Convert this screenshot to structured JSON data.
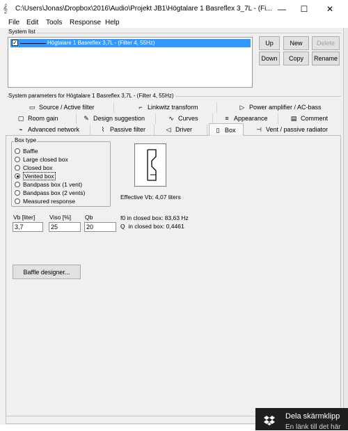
{
  "window": {
    "title": "C:\\Users\\Jonas\\Dropbox\\2016\\Audio\\Projekt JB1\\Högtalare 1 Basreflex 3_7L - (Fi...",
    "minimize": "—",
    "maximize": "☐",
    "close": "✕",
    "app_icon": "speaker-note-icon"
  },
  "menu": [
    "File",
    "Edit",
    "Tools",
    "Response",
    "Help"
  ],
  "system_list": {
    "label": "System list",
    "items": [
      {
        "name": "Högtalare 1 Basreflex 3,7L - (Filter 4, 55Hz)",
        "checked": true,
        "check_glyph": "✓"
      }
    ],
    "buttons": {
      "up": "Up",
      "new": "New",
      "delete": "Delete",
      "down": "Down",
      "copy": "Copy",
      "rename": "Rename"
    }
  },
  "system_parameters": {
    "label": "System parameters for Högtalare 1 Basreflex 3,7L - (Filter 4, 55Hz)"
  },
  "tabs": {
    "row1": [
      {
        "label": "Source / Active filter",
        "icon": "▭",
        "icon_name": "source-icon"
      },
      {
        "label": "Linkwitz transform",
        "icon": "⌐",
        "icon_name": "linkwitz-icon"
      },
      {
        "label": "Power amplifier / AC-bass",
        "icon": "▷",
        "icon_name": "amplifier-icon"
      }
    ],
    "row2": [
      {
        "label": "Room gain",
        "icon": "▢",
        "icon_name": "room-icon"
      },
      {
        "label": "Design suggestion",
        "icon": "✎",
        "icon_name": "pencil-icon"
      },
      {
        "label": "Curves",
        "icon": "∿",
        "icon_name": "curves-icon"
      },
      {
        "label": "Appearance",
        "icon": "≡",
        "icon_name": "appearance-icon"
      },
      {
        "label": "Comment",
        "icon": "▤",
        "icon_name": "comment-icon"
      }
    ],
    "row3": [
      {
        "label": "Advanced network",
        "icon": "⌁",
        "icon_name": "network-icon"
      },
      {
        "label": "Passive filter",
        "icon": "⌇",
        "icon_name": "passive-filter-icon"
      },
      {
        "label": "Driver",
        "icon": "◁",
        "icon_name": "driver-icon"
      },
      {
        "label": "Box",
        "icon": "▯",
        "icon_name": "box-icon"
      },
      {
        "label": "Vent / passive radiator",
        "icon": "⊣",
        "icon_name": "vent-icon"
      }
    ],
    "active": "Box"
  },
  "box_type": {
    "label": "Box type",
    "options": [
      "Baffle",
      "Large closed box",
      "Closed box",
      "Vented box",
      "Bandpass box (1 vent)",
      "Bandpass box (2 vents)",
      "Measured response"
    ],
    "selected": "Vented box"
  },
  "box_info": {
    "effective_vb": "Effective Vb: 4,07 liters",
    "f0_closed": "f0 in closed box: 83,63 Hz",
    "q_closed": "Q  in closed box: 0,4461"
  },
  "fields": {
    "vb": {
      "label": "Vb [liter]",
      "value": "3,7"
    },
    "viso": {
      "label": "Viso [%]",
      "value": "25"
    },
    "qb": {
      "label": "Qb",
      "value": "20"
    }
  },
  "baffle_designer_button": "Baffle designer...",
  "toast": {
    "title": "Dela skärmklipp",
    "subtitle": "En länk till det här",
    "icon": "dropbox-icon",
    "bg_color": "#1f1f1f"
  },
  "colors": {
    "selection": "#3399ff",
    "client_bg": "#f0f0f0"
  }
}
